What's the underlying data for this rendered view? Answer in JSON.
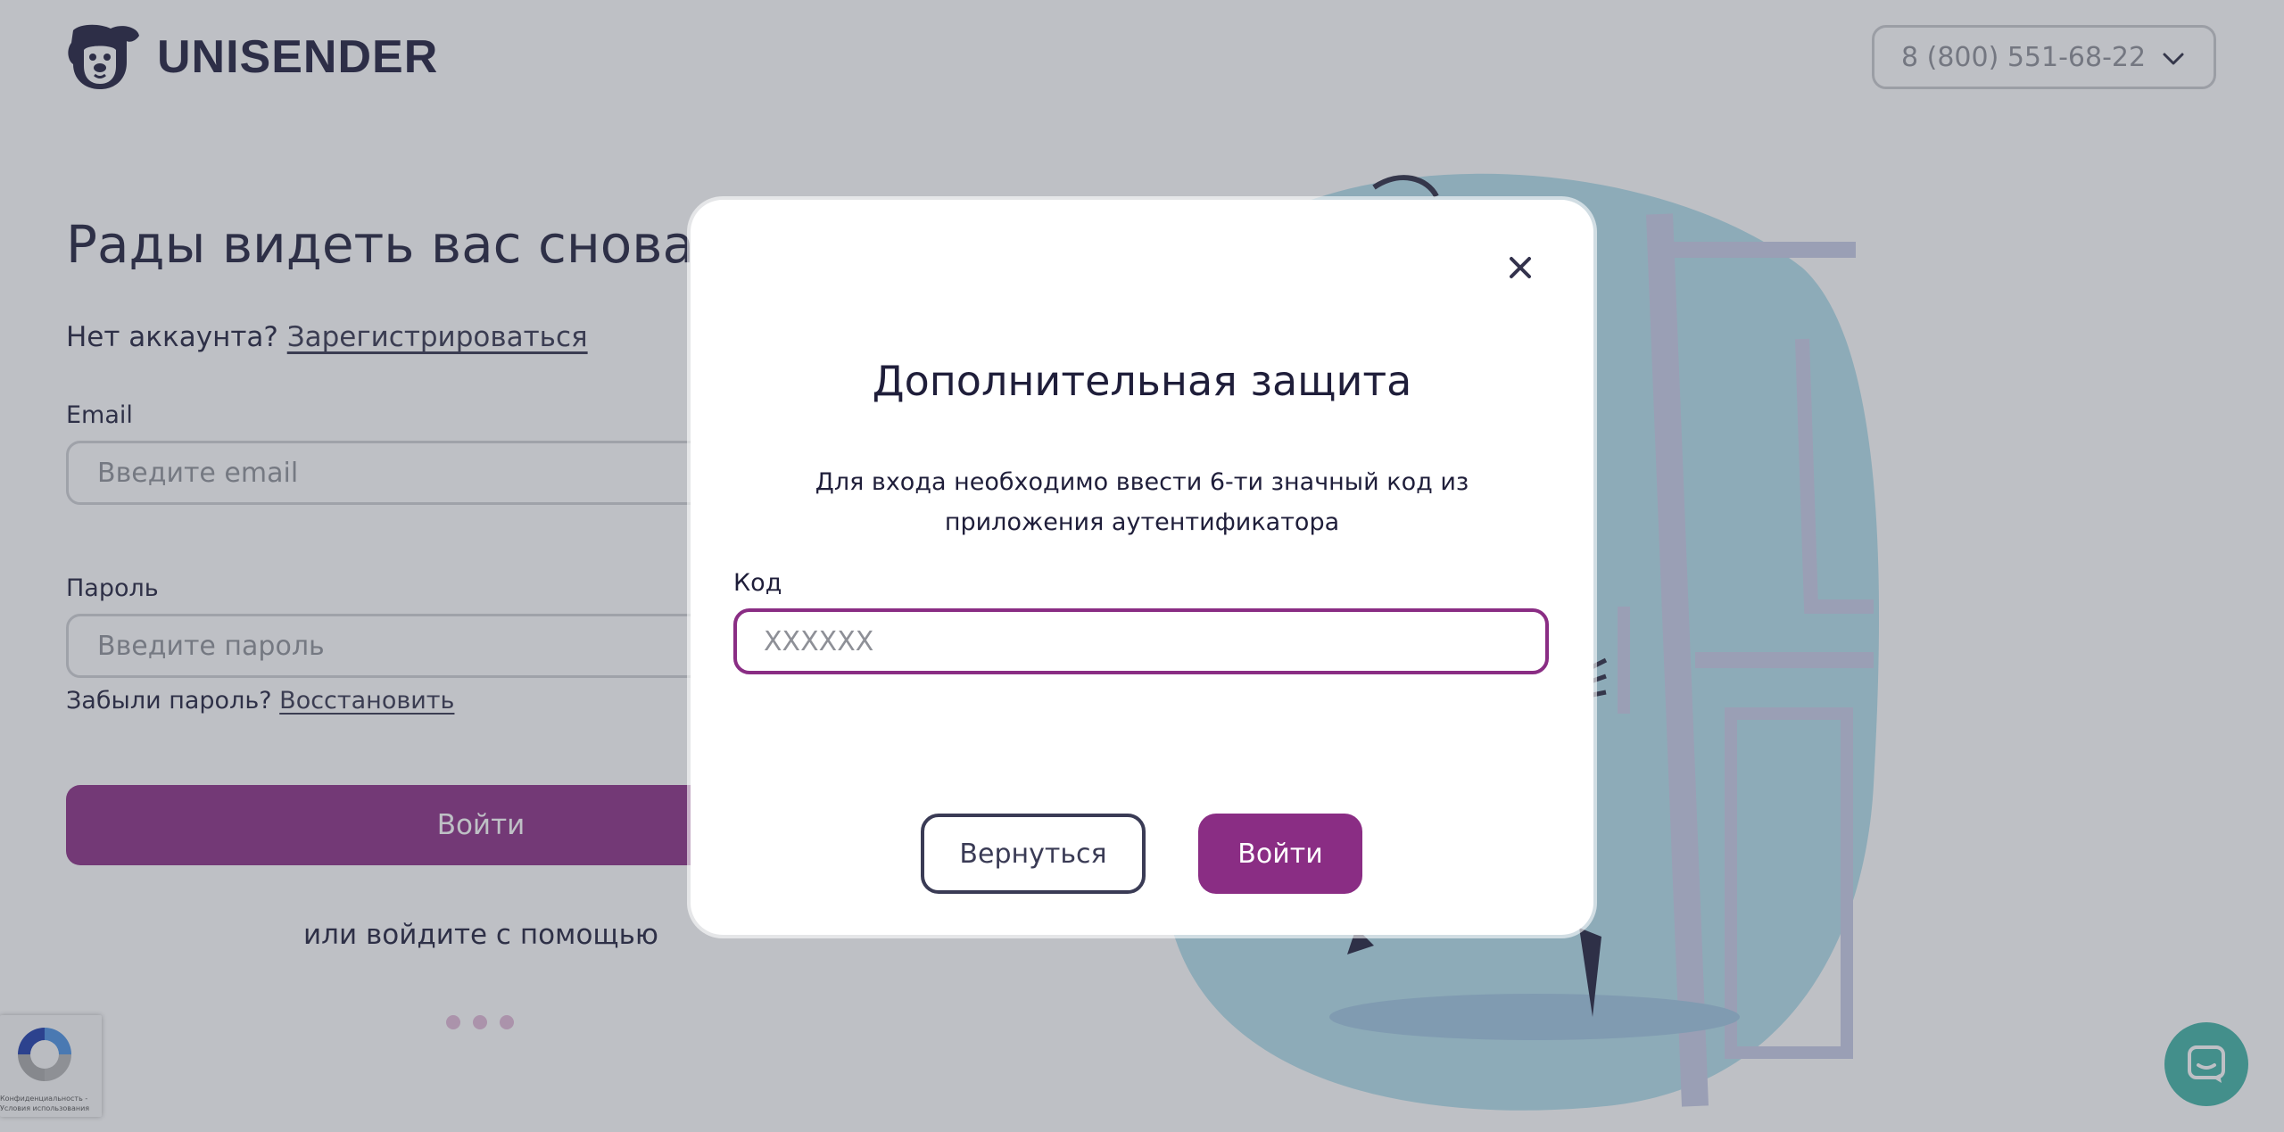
{
  "brand": {
    "name": "UNISENDER"
  },
  "header": {
    "phone": "8 (800) 551-68-22"
  },
  "login_form": {
    "greeting": "Рады видеть вас снова!",
    "no_account_text": "Нет аккаунта?",
    "register_link": "Зарегистрироваться",
    "email_label": "Email",
    "email_placeholder": "Введите email",
    "password_label": "Пароль",
    "password_placeholder": "Введите пароль",
    "forgot_text": "Забыли пароль?",
    "restore_link": "Восстановить",
    "login_button": "Войти",
    "alt_login_text": "или войдите с помощью"
  },
  "recaptcha": {
    "text_line1": "Конфиденциальность -",
    "text_line2": "Условия использования"
  },
  "modal": {
    "title": "Дополнительная защита",
    "description": "Для входа необходимо ввести 6-ти значный код из приложения аутентификатора",
    "code_label": "Код",
    "code_placeholder": "XXXXXX",
    "code_value": "",
    "back_button": "Вернуться",
    "login_button": "Войти"
  },
  "colors": {
    "accent": "#8a2d84",
    "text_dark": "#1f1e3a",
    "chat": "#3fb3a5",
    "illustration_blue": "#b3dfeb"
  },
  "icons": {
    "close": "close-icon",
    "phone_dropdown": "chevron-down-icon",
    "chat": "chat-icon",
    "logo": "dog-logo-icon",
    "recaptcha": "recaptcha-icon"
  }
}
